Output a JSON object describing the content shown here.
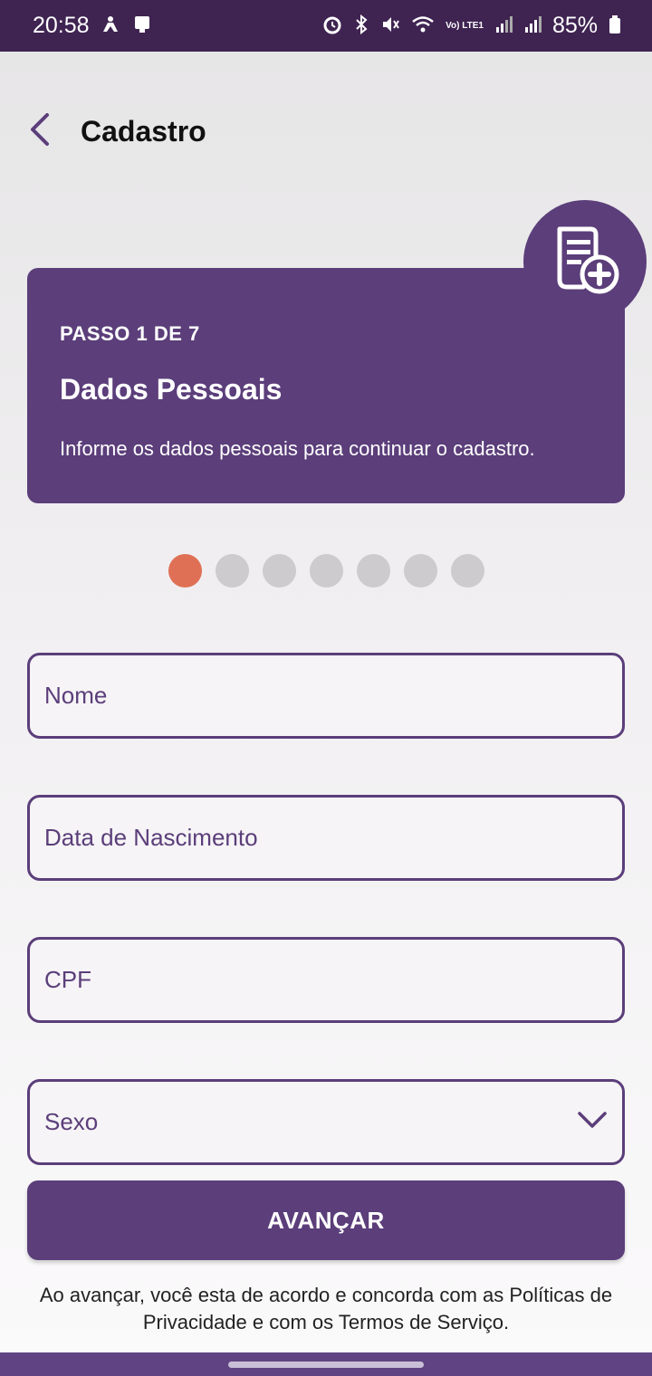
{
  "statusbar": {
    "time": "20:58",
    "battery": "85%",
    "left_icons": [
      "accessibility-icon",
      "screen-cast-icon"
    ],
    "right_icons": [
      "alarm-icon",
      "bluetooth-icon",
      "mute-icon",
      "wifi-icon",
      "volte-icon",
      "signal-icon",
      "signal-icon",
      "battery-icon"
    ],
    "volte_label": "Vo) LTE1"
  },
  "header": {
    "title": "Cadastro",
    "back_icon": "chevron-left-icon"
  },
  "card": {
    "step": "PASSO 1 DE 7",
    "title": "Dados Pessoais",
    "description": "Informe os dados pessoais para continuar o cadastro.",
    "icon": "document-add-icon"
  },
  "progress": {
    "total": 7,
    "current": 1,
    "active_color": "#df7055",
    "inactive_color": "#cdcbcd"
  },
  "form": {
    "fields": [
      {
        "placeholder": "Nome"
      },
      {
        "placeholder": "Data de Nascimento"
      },
      {
        "placeholder": "CPF"
      },
      {
        "placeholder": "Sexo",
        "icon": "chevron-down-icon"
      }
    ]
  },
  "actions": {
    "next_label": "AVANÇAR"
  },
  "terms": {
    "text": "Ao avançar, você esta de acordo e concorda com as Políticas de Privacidade e com os Termos de Serviço."
  },
  "colors": {
    "primary": "#5b3e7a",
    "statusbar": "#3f2452",
    "accent": "#df7055"
  }
}
